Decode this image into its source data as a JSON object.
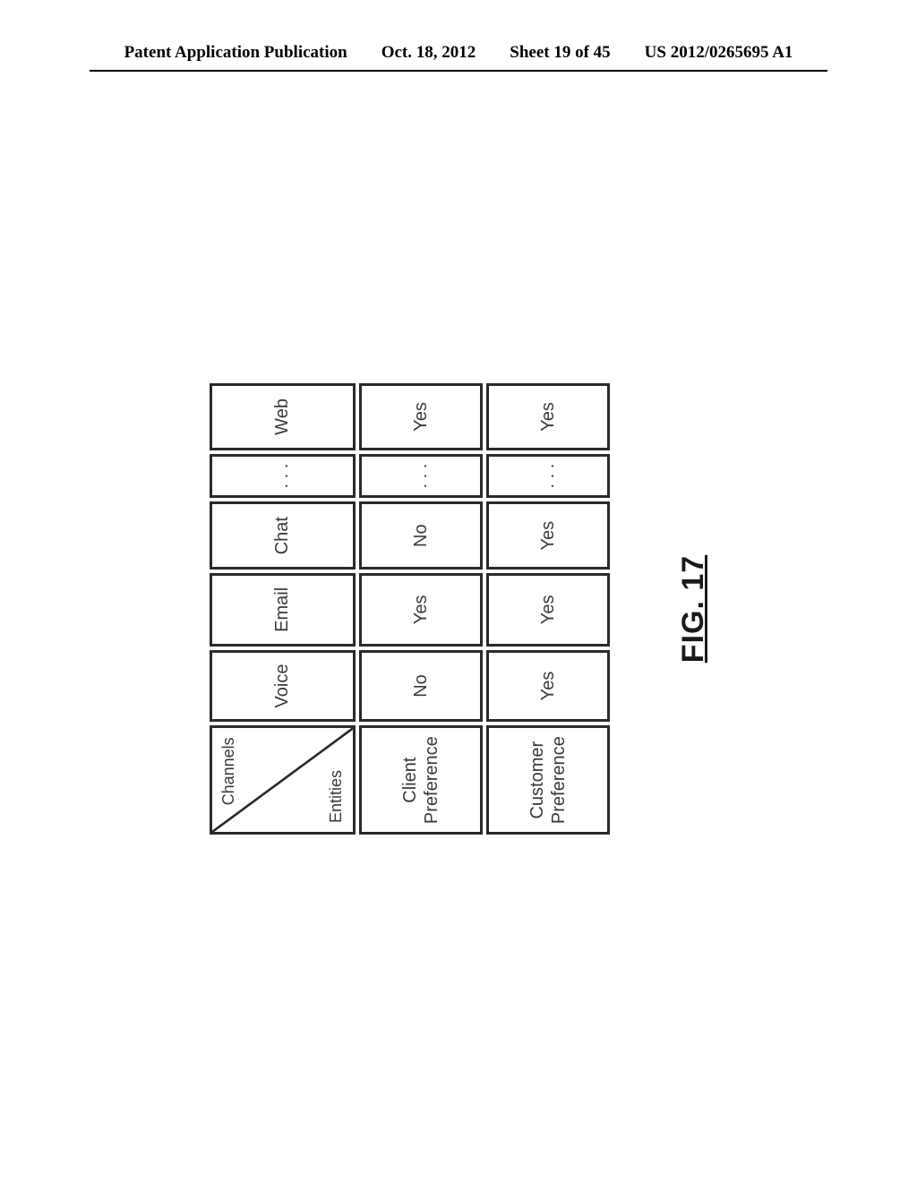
{
  "header": {
    "left": "Patent Application Publication",
    "date": "Oct. 18, 2012",
    "sheet": "Sheet 19 of 45",
    "pubno": "US 2012/0265695 A1"
  },
  "figure": {
    "caption": "FIG. 17",
    "corner_top": "Channels",
    "corner_bottom": "Entities",
    "columns": [
      "Voice",
      "Email",
      "Chat",
      ". . .",
      "Web"
    ],
    "rows": [
      {
        "label": "Client Preference",
        "cells": [
          "No",
          "Yes",
          "No",
          ". . .",
          "Yes"
        ]
      },
      {
        "label": "Customer Preference",
        "cells": [
          "Yes",
          "Yes",
          "Yes",
          ". . .",
          "Yes"
        ]
      }
    ]
  },
  "chart_data": {
    "type": "table",
    "title": "FIG. 17",
    "row_axis": "Entities",
    "col_axis": "Channels",
    "columns": [
      "Voice",
      "Email",
      "Chat",
      "...",
      "Web"
    ],
    "rows": [
      "Client Preference",
      "Customer Preference"
    ],
    "values": [
      [
        "No",
        "Yes",
        "No",
        "...",
        "Yes"
      ],
      [
        "Yes",
        "Yes",
        "Yes",
        "...",
        "Yes"
      ]
    ]
  }
}
